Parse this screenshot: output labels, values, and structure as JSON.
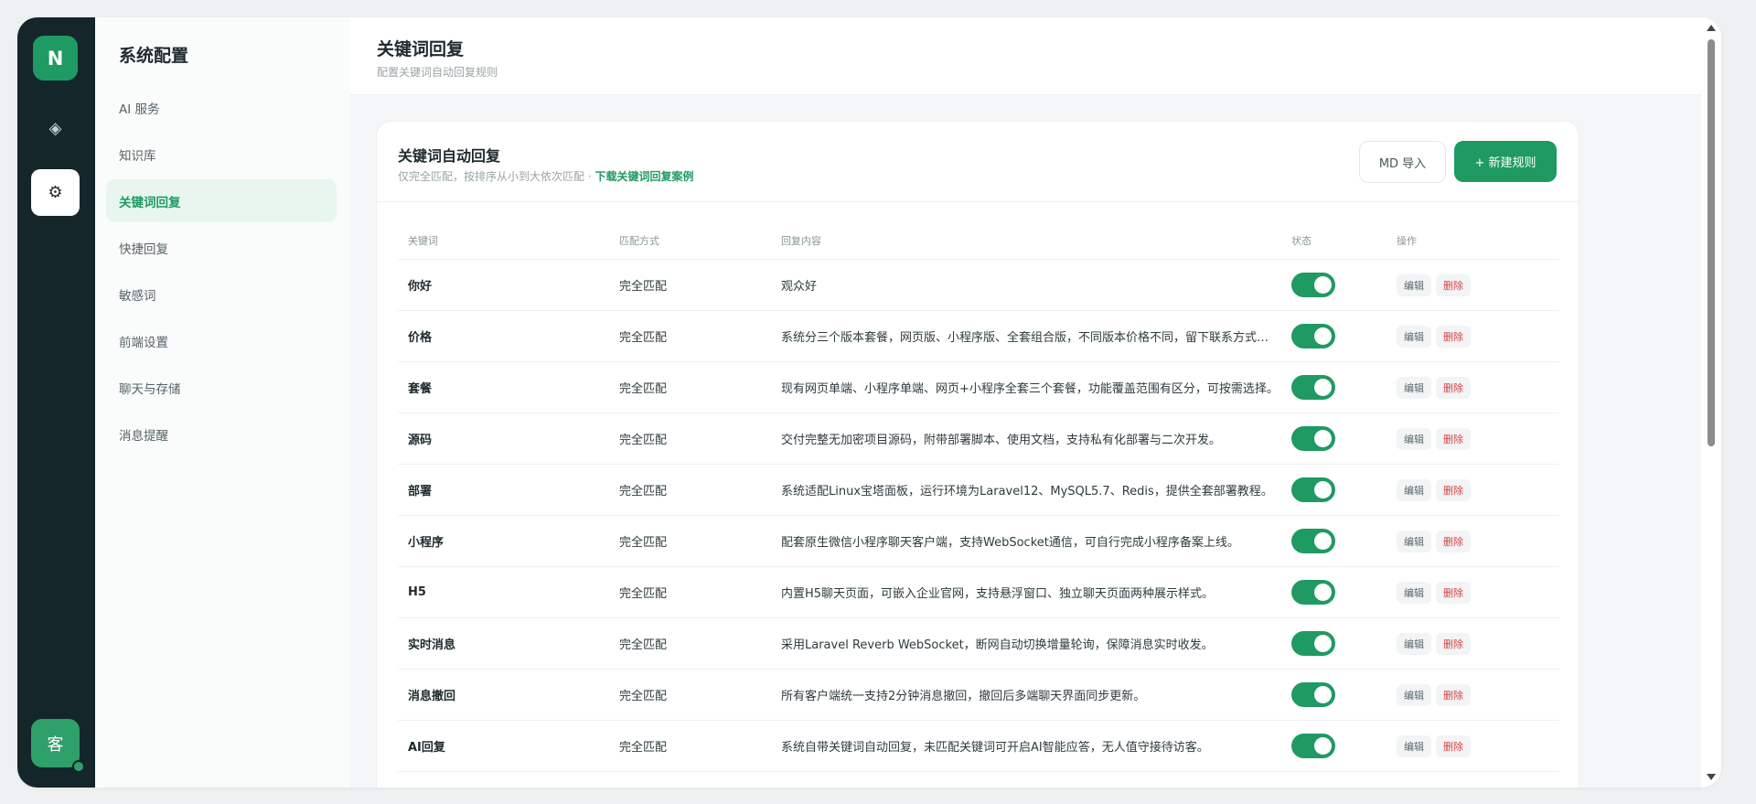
{
  "rail": {
    "logo_letter": "N",
    "items": [
      {
        "icon": "diamond-icon",
        "glyph": "◈"
      },
      {
        "icon": "gear-icon",
        "glyph": "⚙"
      }
    ],
    "avatar_text": "客"
  },
  "subnav": {
    "title": "系统配置",
    "items": [
      {
        "label": "AI 服务"
      },
      {
        "label": "知识库"
      },
      {
        "label": "关键词回复"
      },
      {
        "label": "快捷回复"
      },
      {
        "label": "敏感词"
      },
      {
        "label": "前端设置"
      },
      {
        "label": "聊天与存储"
      },
      {
        "label": "消息提醒"
      }
    ],
    "active_index": 2
  },
  "header": {
    "title": "关键词回复",
    "subtitle": "配置关键词自动回复规则"
  },
  "card": {
    "title": "关键词自动回复",
    "subtitle": "仅完全匹配，按排序从小到大依次匹配 · ",
    "download_link": "下载关键词回复案例",
    "import_label": "MD 导入",
    "new_label": "+ 新建规则"
  },
  "table": {
    "headers": {
      "keyword": "关键词",
      "match": "匹配方式",
      "reply": "回复内容",
      "status": "状态",
      "ops": "操作"
    },
    "edit_label": "编辑",
    "delete_label": "删除",
    "rows": [
      {
        "keyword": "你好",
        "match": "完全匹配",
        "reply": "观众好",
        "enabled": true
      },
      {
        "keyword": "价格",
        "match": "完全匹配",
        "reply": "系统分三个版本套餐，网页版、小程序版、全套组合版，不同版本价格不同，留下联系方式发详细报价。",
        "enabled": true
      },
      {
        "keyword": "套餐",
        "match": "完全匹配",
        "reply": "现有网页单端、小程序单端、网页+小程序全套三个套餐，功能覆盖范围有区分，可按需选择。",
        "enabled": true
      },
      {
        "keyword": "源码",
        "match": "完全匹配",
        "reply": "交付完整无加密项目源码，附带部署脚本、使用文档，支持私有化部署与二次开发。",
        "enabled": true
      },
      {
        "keyword": "部署",
        "match": "完全匹配",
        "reply": "系统适配Linux宝塔面板，运行环境为Laravel12、MySQL5.7、Redis，提供全套部署教程。",
        "enabled": true
      },
      {
        "keyword": "小程序",
        "match": "完全匹配",
        "reply": "配套原生微信小程序聊天客户端，支持WebSocket通信，可自行完成小程序备案上线。",
        "enabled": true
      },
      {
        "keyword": "H5",
        "match": "完全匹配",
        "reply": "内置H5聊天页面，可嵌入企业官网，支持悬浮窗口、独立聊天页面两种展示样式。",
        "enabled": true
      },
      {
        "keyword": "实时消息",
        "match": "完全匹配",
        "reply": "采用Laravel Reverb WebSocket，断网自动切换增量轮询，保障消息实时收发。",
        "enabled": true
      },
      {
        "keyword": "消息撤回",
        "match": "完全匹配",
        "reply": "所有客户端统一支持2分钟消息撤回，撤回后多端聊天界面同步更新。",
        "enabled": true
      },
      {
        "keyword": "AI回复",
        "match": "完全匹配",
        "reply": "系统自带关键词自动回复，未匹配关键词可开启AI智能应答，无人值守接待访客。",
        "enabled": true
      }
    ]
  }
}
